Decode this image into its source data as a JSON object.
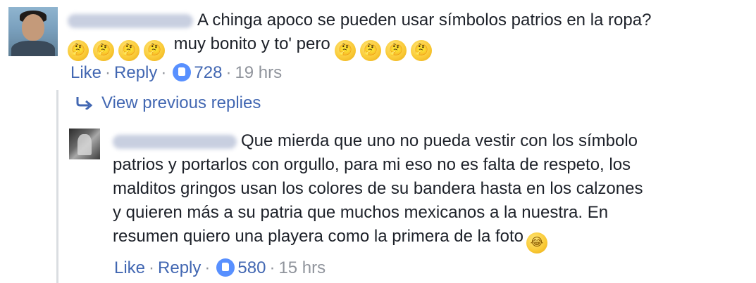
{
  "comment": {
    "text_line1": "A chinga apoco se pueden usar símbolos patrios en la ropa?",
    "text_line2": "muy bonito y to' pero",
    "like_label": "Like",
    "reply_label": "Reply",
    "reaction_count": "728",
    "time": "19 hrs"
  },
  "view_previous": {
    "label": "View previous replies"
  },
  "reply": {
    "lines": [
      "Que mierda que uno no pueda vestir con los símbolo",
      "patrios y portarlos con orgullo, para mi eso no es falta de respeto, los",
      "malditos gringos usan los colores de su bandera hasta en los calzones",
      "y quieren más a su patria que muchos mexicanos a la nuestra. En",
      "resumen quiero una playera como la primera de la foto"
    ],
    "like_label": "Like",
    "reply_label": "Reply",
    "reaction_count": "580",
    "time": "15 hrs"
  },
  "icons": {
    "thinking": "thinking-face-emoji",
    "laugh": "tears-of-joy-emoji",
    "like": "like-thumb-icon",
    "reply_arrow": "reply-arrow-icon"
  },
  "colors": {
    "link": "#4267b2",
    "meta_gray": "#90949c",
    "like_badge": "#5890ff",
    "thread_line": "#dadde1"
  }
}
